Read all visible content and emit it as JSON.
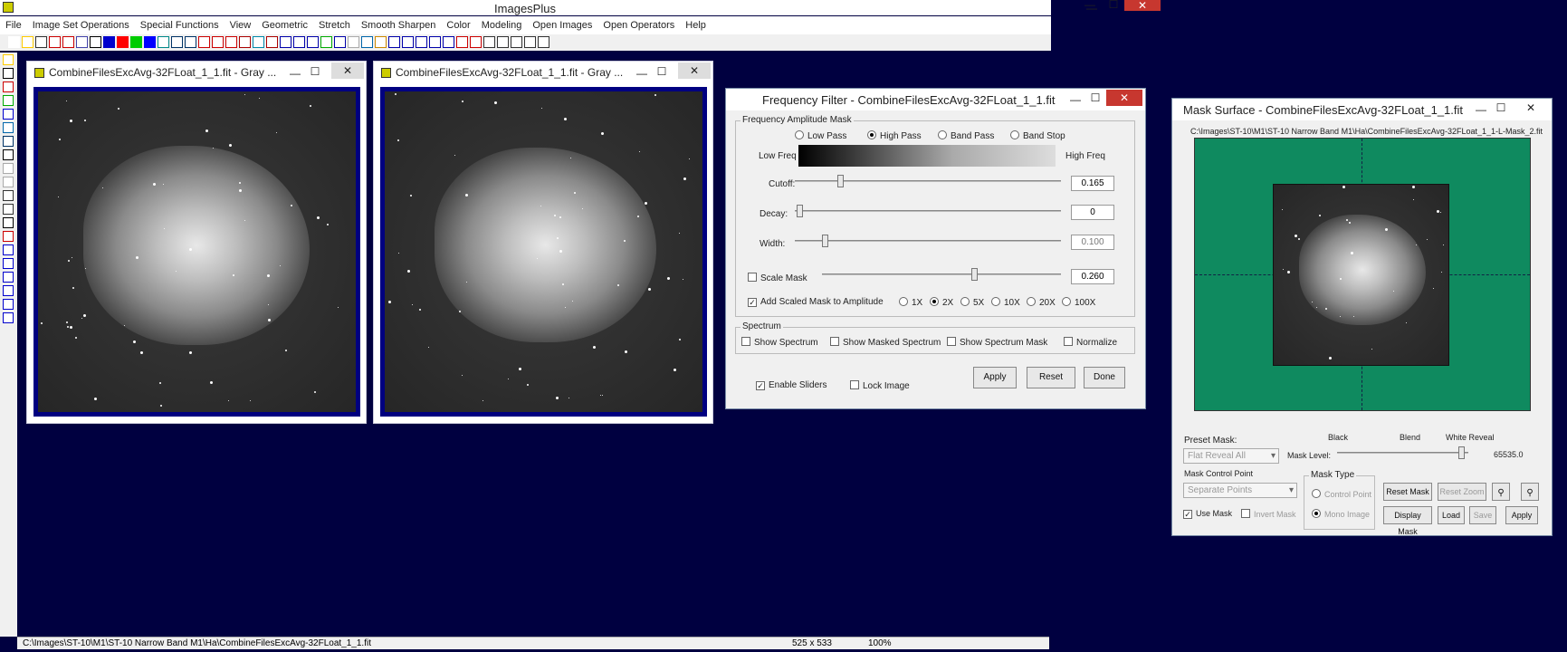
{
  "app": {
    "title": "ImagesPlus",
    "min": "—",
    "max": "☐",
    "close": "✕"
  },
  "menu": [
    "File",
    "Image Set Operations",
    "Special Functions",
    "View",
    "Geometric",
    "Stretch",
    "Smooth Sharpen",
    "Color",
    "Modeling",
    "Open Images",
    "Open Operators",
    "Help"
  ],
  "child1": {
    "title": "CombineFilesExcAvg-32FLoat_1_1.fit - Gray ..."
  },
  "child2": {
    "title": "CombineFilesExcAvg-32FLoat_1_1.fit - Gray ..."
  },
  "freq": {
    "title": "Frequency Filter - CombineFilesExcAvg-32FLoat_1_1.fit",
    "group_mask": "Frequency Amplitude Mask",
    "modes": [
      "Low Pass",
      "High Pass",
      "Band Pass",
      "Band Stop"
    ],
    "low_freq": "Low Freq",
    "high_freq": "High Freq",
    "cutoff_label": "Cutoff:",
    "cutoff_value": "0.165",
    "decay_label": "Decay:",
    "decay_value": "0",
    "width_label": "Width:",
    "width_value": "0.100",
    "scale_mask_label": "Scale Mask",
    "scale_mask_value": "0.260",
    "add_scaled_label": "Add Scaled Mask to Amplitude",
    "multipliers": [
      "1X",
      "2X",
      "5X",
      "10X",
      "20X",
      "100X"
    ],
    "group_spectrum": "Spectrum",
    "show_spectrum": "Show Spectrum",
    "show_masked": "Show Masked Spectrum",
    "show_spectrum_mask": "Show Spectrum Mask",
    "normalize": "Normalize",
    "enable_sliders": "Enable Sliders",
    "lock_image": "Lock Image",
    "apply": "Apply",
    "reset": "Reset",
    "done": "Done"
  },
  "mask": {
    "title": "Mask Surface - CombineFilesExcAvg-32FLoat_1_1.fit",
    "path": "C:\\Images\\ST-10\\M1\\ST-10 Narrow Band M1\\Ha\\CombineFilesExcAvg-32FLoat_1_1-L-Mask_2.fit",
    "preset_label": "Preset Mask:",
    "preset_value": "Flat Reveal All",
    "black": "Black",
    "blend": "Blend",
    "white_reveal": "White Reveal",
    "mask_level_label": "Mask Level:",
    "mask_level_value": "65535.0",
    "control_point_label": "Mask Control Point",
    "control_point_value": "Separate Points",
    "mask_type_label": "Mask Type",
    "control_point_radio": "Control Point",
    "mono_image_radio": "Mono Image",
    "use_mask": "Use Mask",
    "invert_mask": "Invert Mask",
    "reset_mask": "Reset Mask",
    "reset_zoom": "Reset Zoom",
    "display_mask": "Display Mask",
    "load": "Load",
    "save": "Save",
    "apply": "Apply"
  },
  "status": {
    "path": "C:\\Images\\ST-10\\M1\\ST-10 Narrow Band M1\\Ha\\CombineFilesExcAvg-32FLoat_1_1.fit",
    "size": "525 x 533",
    "zoom": "100%"
  },
  "colors": {
    "accent_blue": "#000080",
    "mask_green": "#0f8a5f",
    "close_red": "#c7372f"
  }
}
